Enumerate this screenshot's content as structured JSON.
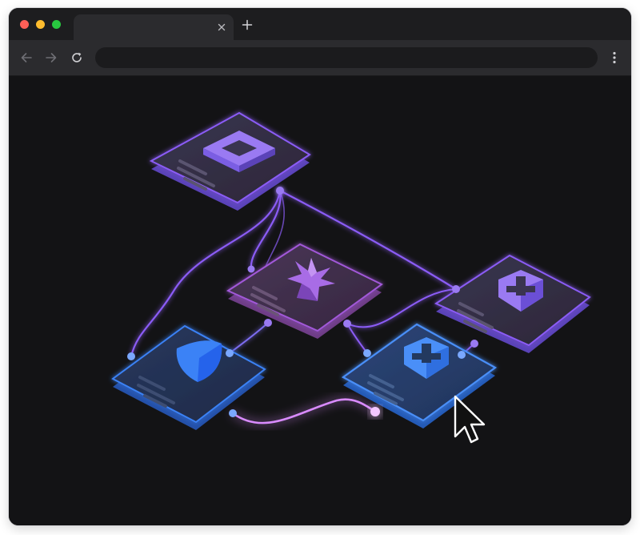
{
  "browser": {
    "tab": {
      "title": ""
    },
    "address_bar": {
      "value": "",
      "placeholder": ""
    },
    "icons": {
      "back": "arrow-left-icon",
      "forward": "arrow-right-icon",
      "reload": "reload-icon",
      "menu": "kebab-menu-icon",
      "tab_close": "close-icon",
      "new_tab": "plus-icon"
    },
    "colors": {
      "close": "#ff5f57",
      "minimize": "#febc2e",
      "maximize": "#28c840",
      "chrome_dark": "#1d1d1f",
      "chrome_toolbar": "#2b2b2e"
    }
  },
  "diagram": {
    "nodes": [
      {
        "id": "top",
        "icon": "square-frame-icon",
        "color": "#8b5cf6"
      },
      {
        "id": "center",
        "icon": "starburst-icon",
        "color": "#a259d9"
      },
      {
        "id": "right",
        "icon": "puzzle-shield-icon",
        "color": "#8b5cf6"
      },
      {
        "id": "left",
        "icon": "shield-icon",
        "color": "#3b82f6"
      },
      {
        "id": "bottom",
        "icon": "puzzle-shield-icon",
        "color": "#3b82f6",
        "selected": true
      }
    ],
    "edges": [
      {
        "from": "top",
        "to": "left"
      },
      {
        "from": "top",
        "to": "center"
      },
      {
        "from": "top",
        "to": "right"
      },
      {
        "from": "center",
        "to": "left"
      },
      {
        "from": "center",
        "to": "bottom"
      },
      {
        "from": "center",
        "to": "right"
      },
      {
        "from": "right",
        "to": "bottom"
      },
      {
        "from": "left",
        "to": "bottom",
        "highlighted": true
      }
    ],
    "cursor": "mouse-pointer-icon"
  }
}
